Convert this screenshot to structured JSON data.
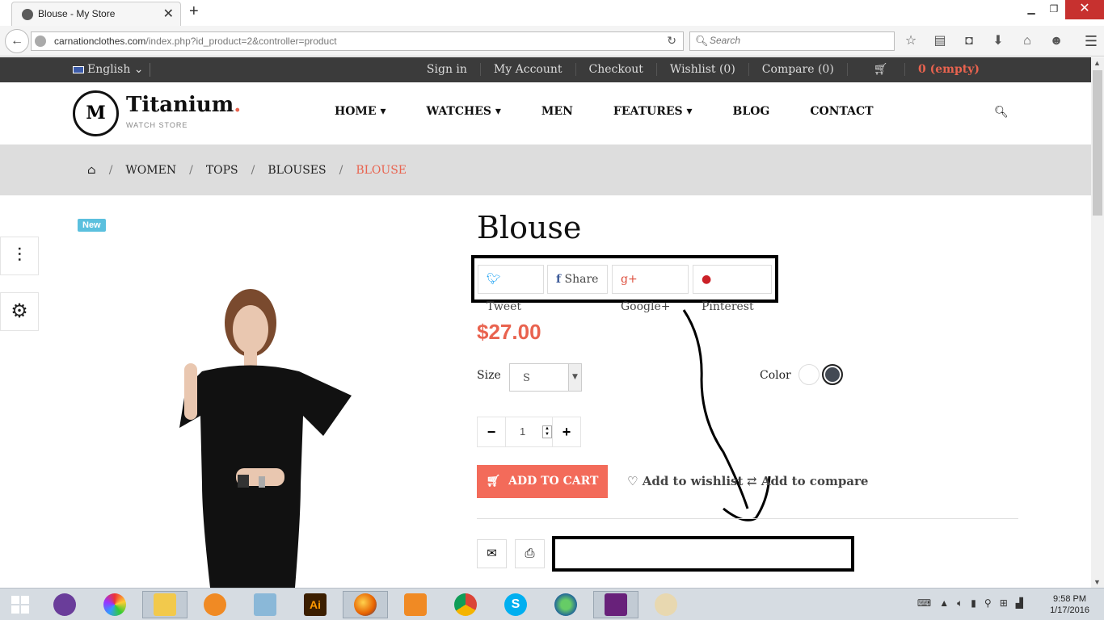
{
  "browser": {
    "tab_title": "Blouse - My Store",
    "url_host": "carnationclothes.com",
    "url_path": "/index.php?id_product=2&controller=product",
    "search_placeholder": "Search"
  },
  "topbar": {
    "language": "English",
    "links": [
      "Sign in",
      "My Account",
      "Checkout",
      "Wishlist (0)",
      "Compare (0)"
    ],
    "cart": "0 (empty)"
  },
  "header": {
    "logo_name": "Titanium",
    "logo_dot": ".",
    "logo_sub": "WATCH STORE",
    "nav": [
      "HOME ▾",
      "WATCHES ▾",
      "MEN",
      "FEATURES ▾",
      "BLOG",
      "CONTACT"
    ]
  },
  "breadcrumb": {
    "items": [
      "WOMEN",
      "TOPS",
      "BLOUSES"
    ],
    "current": "BLOUSE",
    "separator": "/"
  },
  "product": {
    "badge": "New",
    "title": "Blouse",
    "share": {
      "tweet": "Tweet",
      "share": "Share",
      "google": "Google+",
      "pinterest": "Pinterest"
    },
    "price": "$27.00",
    "size_label": "Size",
    "size_value": "S",
    "color_label": "Color",
    "colors": [
      "#ffffff",
      "#434a54"
    ],
    "quantity": "1",
    "add_to_cart": "ADD TO CART",
    "add_to_wishlist": "Add to wishlist",
    "add_to_compare": "Add to compare"
  },
  "taskbar": {
    "time": "9:58 PM",
    "date": "1/17/2016"
  },
  "colors": {
    "accent": "#e9634f",
    "topbar": "#3b3b3b",
    "button": "#f36b5a"
  }
}
